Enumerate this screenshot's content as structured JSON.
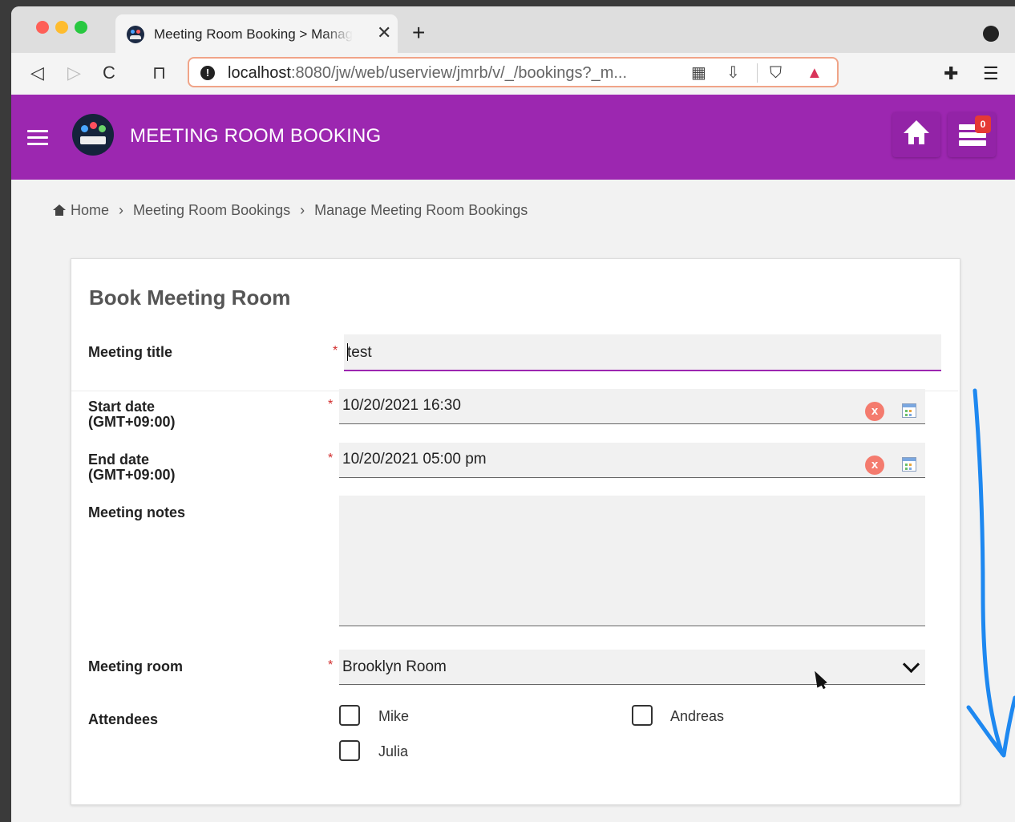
{
  "browser": {
    "tab_title": "Meeting Room Booking > Manage Meeting Room Bookings",
    "tab_close": "✕",
    "new_tab": "+",
    "url_host": "localhost",
    "url_rest": ":8080/jw/web/userview/jmrb/v/_/bookings?_m...",
    "nav": {
      "back": "◁",
      "forward": "▷",
      "reload": "C",
      "bookmark": "⊓"
    },
    "url_icons": [
      "qr-icon",
      "install-icon",
      "brave-shield-icon",
      "brave-rewards-icon"
    ],
    "toolbar_icons": [
      "extensions-icon",
      "menu-icon"
    ]
  },
  "app": {
    "title": "MEETING ROOM BOOKING",
    "inbox_count": "0",
    "brand_color": "#9c27b0"
  },
  "breadcrumb": {
    "items": [
      "Home",
      "Meeting Room Bookings",
      "Manage Meeting Room Bookings"
    ],
    "separator": "›"
  },
  "form": {
    "title": "Book Meeting Room",
    "required_marker": "*",
    "meeting_title": {
      "label": "Meeting title",
      "value": "test"
    },
    "start_date": {
      "label_line1": "Start date",
      "label_line2": "(GMT+09:00)",
      "value": "10/20/2021 16:30"
    },
    "end_date": {
      "label_line1": "End date",
      "label_line2": "(GMT+09:00)",
      "value": "10/20/2021 05:00 pm"
    },
    "meeting_notes": {
      "label": "Meeting notes",
      "value": ""
    },
    "meeting_room": {
      "label": "Meeting room",
      "value": "Brooklyn Room"
    },
    "attendees": {
      "label": "Attendees",
      "options": [
        {
          "label": "Mike",
          "checked": false
        },
        {
          "label": "Andreas",
          "checked": false
        },
        {
          "label": "Julia",
          "checked": false
        }
      ]
    },
    "clear_glyph": "x"
  }
}
